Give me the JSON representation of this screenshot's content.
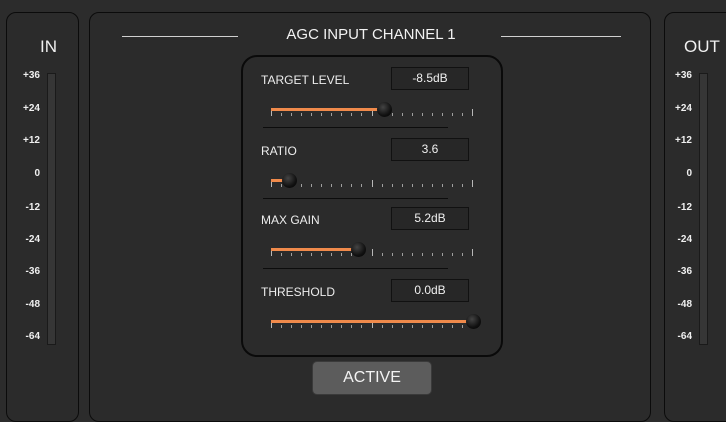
{
  "in_meter": {
    "title": "IN",
    "scale": [
      "+36",
      "+24",
      "+12",
      "0",
      "-12",
      "-24",
      "-36",
      "-48",
      "-64"
    ]
  },
  "out_meter": {
    "title": "OUT",
    "scale": [
      "+36",
      "+24",
      "+12",
      "0",
      "-12",
      "-24",
      "-36",
      "-48",
      "-64"
    ]
  },
  "channel": {
    "title": "AGC INPUT CHANNEL 1",
    "params": [
      {
        "label": "TARGET LEVEL",
        "value": "-8.5dB",
        "fraction": 0.56
      },
      {
        "label": "RATIO",
        "value": "3.6",
        "fraction": 0.09
      },
      {
        "label": "MAX GAIN",
        "value": "5.2dB",
        "fraction": 0.43
      },
      {
        "label": "THRESHOLD",
        "value": "0.0dB",
        "fraction": 1.0
      }
    ],
    "active_label": "ACTIVE"
  },
  "colors": {
    "accent": "#f08a4b",
    "panel": "#2b2b2b",
    "button": "#5c5c5c"
  }
}
